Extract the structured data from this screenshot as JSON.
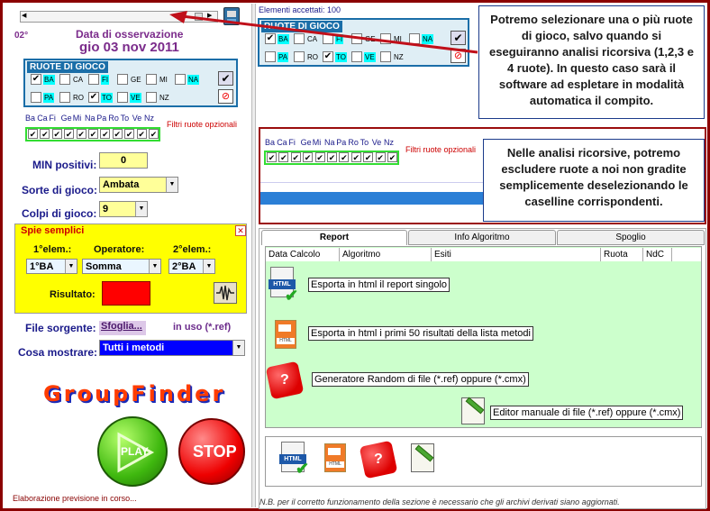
{
  "left_panel": {
    "corner_code": "02°",
    "obs_label": "Data di osservazione",
    "obs_date": "gio 03 nov 2011",
    "ruote_title": "RUOTE DI GIOCO",
    "ruote_row1": [
      "BA",
      "CA",
      "FI",
      "GE",
      "MI",
      "NA"
    ],
    "ruote_row2": [
      "PA",
      "RO",
      "TO",
      "VE",
      "NZ"
    ],
    "filter_header": [
      "Ba",
      "Ca",
      "Fi",
      "Ge",
      "Mi",
      "Na",
      "Pa",
      "Ro",
      "To",
      "Ve",
      "Nz"
    ],
    "filter_label": "Filtri ruote opzionali",
    "min_positivi_label": "MIN positivi:",
    "min_positivi_value": "0",
    "sorte_label": "Sorte di gioco:",
    "sorte_value": "Ambata",
    "colpi_label": "Colpi di gioco:",
    "colpi_value": "9",
    "spie_title": "Spie semplici",
    "elem1_label": "1°elem.:",
    "operatore_label": "Operatore:",
    "elem2_label": "2°elem.:",
    "elem1_value": "1°BA",
    "operatore_value": "Somma",
    "elem2_value": "2°BA",
    "risultato_label": "Risultato:",
    "file_label": "File sorgente:",
    "file_button": "Sfoglia...",
    "file_status": "in uso (*.ref)",
    "cosa_label": "Cosa mostrare:",
    "cosa_value": "Tutti i metodi",
    "logo_text": "GroupFinder",
    "play_label": "PLAY",
    "stop_label": "STOP",
    "status_text": "Elaborazione previsione in corso..."
  },
  "right_panel": {
    "accepted": "Elementi accettati: 100",
    "ruote_title": "RUOTE DI GIOCO",
    "ruote_row1": [
      "BA",
      "CA",
      "FI",
      "GE",
      "MI",
      "NA"
    ],
    "ruote_row2": [
      "PA",
      "RO",
      "TO",
      "VE",
      "NZ"
    ],
    "filter_header": [
      "Ba",
      "Ca",
      "Fi",
      "Ge",
      "Mi",
      "Na",
      "Pa",
      "Ro",
      "To",
      "Ve",
      "Nz"
    ],
    "filter_label": "Filtri ruote opzionali",
    "tabs": [
      "Report",
      "Info Algoritmo",
      "Spoglio"
    ],
    "columns": [
      "Data Calcolo",
      "Algoritmo",
      "Esiti",
      "Ruota",
      "NdC"
    ],
    "actions": [
      "Esporta in html il report singolo",
      "Esporta in html i primi 50 risultati della lista metodi",
      "Generatore Random di file (*.ref) oppure (*.cmx)",
      "Editor manuale di file (*.ref) oppure (*.cmx)"
    ],
    "footnote": "N.B. per il corretto funzionamento della sezione è necessario che gli archivi derivati siano aggiornati."
  },
  "callouts": {
    "top": "Potremo selezionare una o più ruote di gioco, salvo quando si eseguiranno analisi ricorsiva (1,2,3 e 4 ruote). In questo caso sarà il software ad espletare in modalità automatica il compito.",
    "middle": "Nelle analisi ricorsive, potremo escludere ruote a noi non gradite semplicemente deselezionando le caselline corrispondenti."
  },
  "colors": {
    "frame": "#8b0000",
    "ruote_header": "#1a6ea8",
    "grid_bg": "#ccffcc",
    "spie_bg": "#ffff00",
    "highlight": "#00ffff"
  }
}
